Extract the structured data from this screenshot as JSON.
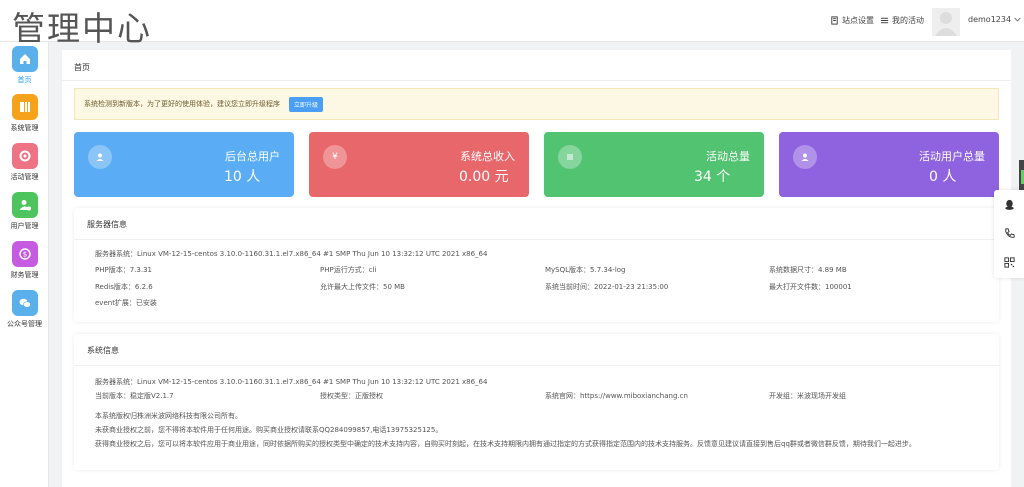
{
  "header": {
    "logo": "管理中心",
    "site_settings": "站点设置",
    "my_activity": "我的活动",
    "username": "demo1234"
  },
  "sidebar": {
    "items": [
      {
        "label": "首页",
        "icon": "home-icon",
        "color": "#5ab0ea"
      },
      {
        "label": "系统管理",
        "icon": "system-grid-icon",
        "color": "#f7a21b"
      },
      {
        "label": "活动管理",
        "icon": "gift-icon",
        "color": "#ee7384"
      },
      {
        "label": "用户管理",
        "icon": "user-gear-icon",
        "color": "#4dc45e"
      },
      {
        "label": "财务管理",
        "icon": "money-icon",
        "color": "#c55be0"
      },
      {
        "label": "公众号管理",
        "icon": "wechat-icon",
        "color": "#5ab0ea"
      }
    ]
  },
  "breadcrumb": "首页",
  "notice": {
    "text": "系统检测到新版本，为了更好的使用体验，建议您立即升级程序",
    "button": "立即升级"
  },
  "stats": [
    {
      "title": "后台总用户",
      "value": "10 人",
      "color": "#5aadf4",
      "icon": "user-icon"
    },
    {
      "title": "系统总收入",
      "value": "0.00 元",
      "color": "#e8676b",
      "icon": "yen-icon"
    },
    {
      "title": "活动总量",
      "value": "34 个",
      "color": "#52c371",
      "icon": "list-icon"
    },
    {
      "title": "活动用户总量",
      "value": "0 人",
      "color": "#8f63e0",
      "icon": "user-icon"
    }
  ],
  "server_info": {
    "title": "服务器信息",
    "os": "服务器系统：Linux VM-12-15-centos 3.10.0-1160.31.1.el7.x86_64 #1 SMP Thu Jun 10 13:32:12 UTC 2021 x86_64",
    "php_version": "PHP版本：7.3.31",
    "php_mode": "PHP运行方式：cli",
    "mysql_version": "MySQL版本：5.7.34-log",
    "db_size": "系统数据尺寸：4.89 MB",
    "redis_version": "Redis版本：6.2.6",
    "upload_max": "允许最大上传文件：50 MB",
    "server_time": "系统当前时间：2022-01-23 21:35:00",
    "max_files": "最大打开文件数：100001",
    "event_ext": "event扩展：已安装"
  },
  "system_info": {
    "title": "系统信息",
    "os": "服务器系统：Linux VM-12-15-centos 3.10.0-1160.31.1.el7.x86_64 #1 SMP Thu Jun 10 13:32:12 UTC 2021 x86_64",
    "version": "当前版本：稳定版V2.1.7",
    "license": "授权类型：正版授权",
    "website": "系统官网：https://www.miboxianchang.cn",
    "dev_team": "开发组：米波现场开发组",
    "copyright": "本系统版权归株洲米波网络科技有限公司所有。",
    "unlicensed": "未获商业授权之前，您不得将本软件用于任何用途。购买商业授权请联系QQ284099857,电话13975325125。",
    "licensed": "获得商业授权之后，您可以将本软件应用于商业用途，同时依据所购买的授权类型中确定的技术支持内容，自购买时刻起，在技术支持期限内拥有通过指定的方式获得指定范围内的技术支持服务。反馈意见建议请直接到售后qq群或者微信群反馈，期待我们一起进步。"
  }
}
